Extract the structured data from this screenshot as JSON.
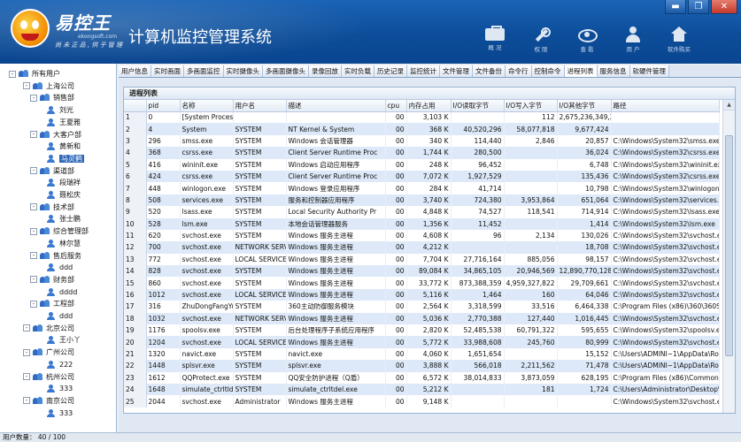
{
  "header": {
    "logo_text": "易控王",
    "logo_domain": "ekongsoft.com",
    "logo_slogan": "尚 未 正 品 , 供 于 管 理",
    "app_title": "计算机监控管理系统",
    "toolbar": [
      {
        "label": "概 况",
        "icon": "briefcase-icon"
      },
      {
        "label": "权 限",
        "icon": "wrench-icon"
      },
      {
        "label": "查 看",
        "icon": "eye-icon"
      },
      {
        "label": "用 户",
        "icon": "user-icon"
      },
      {
        "label": "软件购买",
        "icon": "home-icon"
      }
    ],
    "window_buttons": {
      "minimize": "▬",
      "restore": "❐",
      "close": "✕"
    }
  },
  "tree": [
    {
      "label": "所有用户",
      "exp": "-",
      "icon": "group",
      "depth": 0
    },
    {
      "label": "上海公司",
      "exp": "-",
      "icon": "group",
      "depth": 1
    },
    {
      "label": "销售部",
      "exp": "-",
      "icon": "group",
      "depth": 2
    },
    {
      "label": "刘光",
      "exp": "",
      "icon": "user",
      "depth": 3
    },
    {
      "label": "王夏雅",
      "exp": "",
      "icon": "user",
      "depth": 3
    },
    {
      "label": "大客户部",
      "exp": "-",
      "icon": "group",
      "depth": 2
    },
    {
      "label": "黄新和",
      "exp": "",
      "icon": "user",
      "depth": 3
    },
    {
      "label": "马灵鹤",
      "exp": "",
      "icon": "user",
      "depth": 3,
      "selected": true
    },
    {
      "label": "渠道部",
      "exp": "-",
      "icon": "group",
      "depth": 2
    },
    {
      "label": "段瑞祥",
      "exp": "",
      "icon": "user",
      "depth": 3
    },
    {
      "label": "聂松庆",
      "exp": "",
      "icon": "user",
      "depth": 3
    },
    {
      "label": "技术部",
      "exp": "-",
      "icon": "group",
      "depth": 2
    },
    {
      "label": "张士鹏",
      "exp": "",
      "icon": "user",
      "depth": 3
    },
    {
      "label": "综合管理部",
      "exp": "-",
      "icon": "group",
      "depth": 2
    },
    {
      "label": "林尔慧",
      "exp": "",
      "icon": "user",
      "depth": 3
    },
    {
      "label": "售后服务",
      "exp": "-",
      "icon": "group",
      "depth": 2
    },
    {
      "label": "ddd",
      "exp": "",
      "icon": "user",
      "depth": 3
    },
    {
      "label": "财务部",
      "exp": "-",
      "icon": "group",
      "depth": 2
    },
    {
      "label": "dddd",
      "exp": "",
      "icon": "user",
      "depth": 3
    },
    {
      "label": "工程部",
      "exp": "-",
      "icon": "group",
      "depth": 2
    },
    {
      "label": "ddd",
      "exp": "",
      "icon": "user",
      "depth": 3
    },
    {
      "label": "北京公司",
      "exp": "-",
      "icon": "group",
      "depth": 1
    },
    {
      "label": "王小丫",
      "exp": "",
      "icon": "user",
      "depth": 3
    },
    {
      "label": "广州公司",
      "exp": "-",
      "icon": "group",
      "depth": 1
    },
    {
      "label": "222",
      "exp": "",
      "icon": "user",
      "depth": 3
    },
    {
      "label": "杭州公司",
      "exp": "-",
      "icon": "group",
      "depth": 1
    },
    {
      "label": "333",
      "exp": "",
      "icon": "user",
      "depth": 3
    },
    {
      "label": "南京公司",
      "exp": "-",
      "icon": "group",
      "depth": 1
    },
    {
      "label": "333",
      "exp": "",
      "icon": "user",
      "depth": 3
    }
  ],
  "tabs": [
    "用户信息",
    "实时画面",
    "多画面监控",
    "实时摄像头",
    "多画面摄像头",
    "录像回放",
    "实时负载",
    "历史记录",
    "监控统计",
    "文件管理",
    "文件备份",
    "命令行",
    "控制命令",
    "进程列表",
    "服务信息",
    "软硬件管理"
  ],
  "active_tab": "进程列表",
  "process_list": {
    "title": "进程列表",
    "columns": [
      "",
      "pid",
      "名称",
      "用户名",
      "描述",
      "cpu",
      "内存占用",
      "I/O读取字节",
      "I/O写入字节",
      "I/O其他字节",
      "路径"
    ],
    "rows": [
      [
        "1",
        "0",
        "[System Process]",
        "",
        "",
        "00",
        "3,103 K",
        "",
        "112",
        "2,675,236,349,28",
        ""
      ],
      [
        "2",
        "4",
        "System",
        "SYSTEM",
        "NT Kernel & System",
        "00",
        "368 K",
        "40,520,296",
        "58,077,818",
        "9,677,424",
        ""
      ],
      [
        "3",
        "296",
        "smss.exe",
        "SYSTEM",
        "Windows 会话管理器",
        "00",
        "340 K",
        "114,440",
        "2,846",
        "20,857",
        "C:\\Windows\\System32\\smss.exe"
      ],
      [
        "4",
        "368",
        "csrss.exe",
        "SYSTEM",
        "Client Server Runtime Proc",
        "00",
        "1,744 K",
        "280,500",
        "",
        "36,024",
        "C:\\Windows\\System32\\csrss.exe"
      ],
      [
        "5",
        "416",
        "wininit.exe",
        "SYSTEM",
        "Windows 启动应用程序",
        "00",
        "248 K",
        "96,452",
        "",
        "6,748",
        "C:\\Windows\\System32\\wininit.exe"
      ],
      [
        "6",
        "424",
        "csrss.exe",
        "SYSTEM",
        "Client Server Runtime Proc",
        "00",
        "7,072 K",
        "1,927,529",
        "",
        "135,436",
        "C:\\Windows\\System32\\csrss.exe"
      ],
      [
        "7",
        "448",
        "winlogon.exe",
        "SYSTEM",
        "Windows 登录应用程序",
        "00",
        "284 K",
        "41,714",
        "",
        "10,798",
        "C:\\Windows\\System32\\winlogon.exe"
      ],
      [
        "8",
        "508",
        "services.exe",
        "SYSTEM",
        "服务和控制器应用程序",
        "00",
        "3,740 K",
        "724,380",
        "3,953,864",
        "651,064",
        "C:\\Windows\\System32\\services.exe"
      ],
      [
        "9",
        "520",
        "lsass.exe",
        "SYSTEM",
        "Local Security Authority Pr",
        "00",
        "4,848 K",
        "74,527",
        "118,541",
        "714,914",
        "C:\\Windows\\System32\\lsass.exe"
      ],
      [
        "10",
        "528",
        "lsm.exe",
        "SYSTEM",
        "本地会话管理器服务",
        "00",
        "1,356 K",
        "11,452",
        "",
        "1,414",
        "C:\\Windows\\System32\\lsm.exe"
      ],
      [
        "11",
        "620",
        "svchost.exe",
        "SYSTEM",
        "Windows 服务主进程",
        "00",
        "4,608 K",
        "96",
        "2,134",
        "130,026",
        "C:\\Windows\\System32\\svchost.exe"
      ],
      [
        "12",
        "700",
        "svchost.exe",
        "NETWORK SERVI",
        "Windows 服务主进程",
        "00",
        "4,212 K",
        "",
        "",
        "18,708",
        "C:\\Windows\\System32\\svchost.exe"
      ],
      [
        "13",
        "772",
        "svchost.exe",
        "LOCAL SERVICE",
        "Windows 服务主进程",
        "00",
        "7,704 K",
        "27,716,164",
        "885,056",
        "98,157",
        "C:\\Windows\\System32\\svchost.exe"
      ],
      [
        "14",
        "828",
        "svchost.exe",
        "SYSTEM",
        "Windows 服务主进程",
        "00",
        "89,084 K",
        "34,865,105",
        "20,946,569",
        "12,890,770,128",
        "C:\\Windows\\System32\\svchost.exe"
      ],
      [
        "15",
        "860",
        "svchost.exe",
        "SYSTEM",
        "Windows 服务主进程",
        "00",
        "33,772 K",
        "873,388,359",
        "4,959,327,822",
        "29,709,661",
        "C:\\Windows\\System32\\svchost.exe"
      ],
      [
        "16",
        "1012",
        "svchost.exe",
        "LOCAL SERVICE",
        "Windows 服务主进程",
        "00",
        "5,116 K",
        "1,464",
        "160",
        "64,046",
        "C:\\Windows\\System32\\svchost.exe"
      ],
      [
        "17",
        "316",
        "ZhuDongFangYu.e",
        "SYSTEM",
        "360主动防御服务模块",
        "00",
        "2,564 K",
        "3,318,599",
        "33,516",
        "6,464,338",
        "C:\\Program Files (x86)\\360\\360Safe"
      ],
      [
        "18",
        "1032",
        "svchost.exe",
        "NETWORK SERVI",
        "Windows 服务主进程",
        "00",
        "5,036 K",
        "2,770,388",
        "127,440",
        "1,016,445",
        "C:\\Windows\\System32\\svchost.exe"
      ],
      [
        "19",
        "1176",
        "spoolsv.exe",
        "SYSTEM",
        "后台处理程序子系统应用程序",
        "00",
        "2,820 K",
        "52,485,538",
        "60,791,322",
        "595,655",
        "C:\\Windows\\System32\\spoolsv.exe"
      ],
      [
        "20",
        "1204",
        "svchost.exe",
        "LOCAL SERVICE",
        "Windows 服务主进程",
        "00",
        "5,772 K",
        "33,988,608",
        "245,760",
        "80,999",
        "C:\\Windows\\System32\\svchost.exe"
      ],
      [
        "21",
        "1320",
        "navict.exe",
        "SYSTEM",
        "navict.exe",
        "00",
        "4,060 K",
        "1,651,654",
        "",
        "15,152",
        "C:\\Users\\ADMINI~1\\AppData\\Roaming"
      ],
      [
        "22",
        "1448",
        "splsvr.exe",
        "SYSTEM",
        "splsvr.exe",
        "00",
        "3,888 K",
        "566,018",
        "2,211,562",
        "71,478",
        "C:\\Users\\ADMINI~1\\AppData\\Roaming"
      ],
      [
        "23",
        "1612",
        "QQProtect.exe",
        "SYSTEM",
        "QQ安全防护进程（Q盾）",
        "00",
        "6,572 K",
        "38,014,833",
        "3,873,059",
        "628,195",
        "C:\\Program Files (x86)\\Common Files"
      ],
      [
        "24",
        "1648",
        "simulate_ctrltlde",
        "SYSTEM",
        "simulate_ctrltdel.exe",
        "00",
        "5,212 K",
        "",
        "181",
        "1,724",
        "C:\\Users\\Administrator\\Desktop\\"
      ],
      [
        "25",
        "2044",
        "svchost.exe",
        "Administrator",
        "Windows 服务主进程",
        "00",
        "9,148 K",
        "",
        "",
        "",
        "C:\\Windows\\System32\\svchost.exe"
      ]
    ]
  },
  "status_bar": {
    "text": "用户数量： 40 / 100"
  }
}
